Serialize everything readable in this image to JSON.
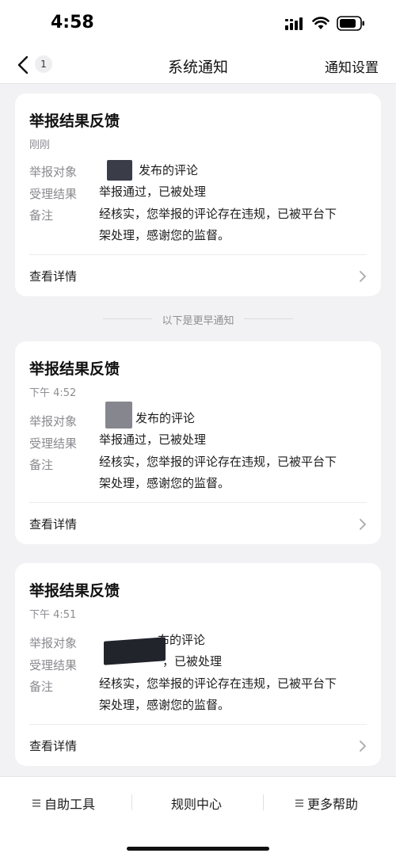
{
  "status_bar": {
    "time": "4:58"
  },
  "nav": {
    "back_badge": "1",
    "title": "系统通知",
    "settings": "通知设置"
  },
  "labels": {
    "target": "举报对象",
    "result": "受理结果",
    "remark": "备注",
    "detail": "查看详情"
  },
  "notifications": [
    {
      "title": "举报结果反馈",
      "time": "刚刚",
      "target": "发布的评论",
      "result": "举报通过，已被处理",
      "remark_line1": "经核实，您举报的评论存在违规，已被平台下",
      "remark_line2": "架处理，感谢您的监督。"
    },
    {
      "title": "举报结果反馈",
      "time": "下午 4:52",
      "target": "发布的评论",
      "result": "举报通过，已被处理",
      "remark_line1": "经核实，您举报的评论存在违规，已被平台下",
      "remark_line2": "架处理，感谢您的监督。"
    },
    {
      "title": "举报结果反馈",
      "time": "下午 4:51",
      "target": "布的评论",
      "result": "，已被处理",
      "remark_line1": "经核实，您举报的评论存在违规，已被平台下",
      "remark_line2": "架处理，感谢您的监督。"
    }
  ],
  "separator": "以下是更早通知",
  "bottom_bar": {
    "self_help": "自助工具",
    "rules": "规则中心",
    "more_help": "更多帮助"
  }
}
